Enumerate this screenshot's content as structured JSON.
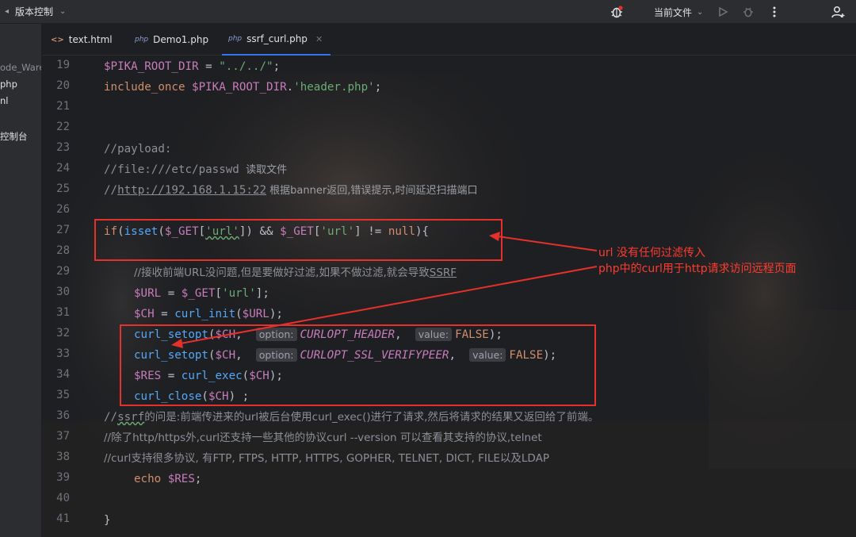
{
  "titlebar": {
    "vcs_label": "版本控制",
    "current_file_label": "当前文件",
    "icons": [
      "menu-icon",
      "debug-bug-icon",
      "run-icon",
      "debug-icon",
      "more-icon",
      "add-user-icon"
    ]
  },
  "project_tree": {
    "items": [
      "ode_Ware",
      "php",
      "nl",
      "控制台"
    ]
  },
  "tabs": [
    {
      "label": "text.html",
      "icon": "html-icon"
    },
    {
      "label": "Demo1.php",
      "icon": "php"
    },
    {
      "label": "ssrf_curl.php",
      "icon": "php",
      "active": true
    }
  ],
  "editor": {
    "line_numbers": [
      "19",
      "20",
      "21",
      "22",
      "23",
      "24",
      "25",
      "26",
      "27",
      "28",
      "29",
      "30",
      "31",
      "32",
      "33",
      "34",
      "35",
      "36",
      "37",
      "38",
      "39",
      "40",
      "41"
    ],
    "lines": {
      "l19": {
        "var": "$PIKA_ROOT_DIR",
        "op": " = ",
        "str": "\"../../\"",
        "end": ";"
      },
      "l20": {
        "kw": "include_once ",
        "var": "$PIKA_ROOT_DIR",
        "op": ".",
        "str": "'header.php'",
        "end": ";"
      },
      "l23": {
        "cmt": "//payload:"
      },
      "l24": {
        "cmt": "//file:///etc/passwd",
        "cn": "  读取文件"
      },
      "l25": {
        "cmt1": "//",
        "url": "http://192.168.1.15:22",
        "cn": " 根据banner返回,错误提示,时间延迟扫描端口"
      },
      "l27": {
        "kw1": "if",
        "p1": "(",
        "fn1": "isset",
        "p2": "(",
        "var1": "$_GET",
        "p3": "[",
        "s1": "'url'",
        "p4": "]) && ",
        "var2": "$_GET",
        "p5": "[",
        "s2": "'url'",
        "p6": "] != ",
        "kw2": "null",
        "p7": "){"
      },
      "l29": {
        "cmt": "//接收前端URL没问题,但是要做好过滤,如果不做过滤,就会导致",
        "tail": "SSRF"
      },
      "l30": {
        "var1": "$URL",
        "op": " = ",
        "var2": "$_GET",
        "p1": "[",
        "s": "'url'",
        "p2": "];"
      },
      "l31": {
        "var1": "$CH",
        "op": " = ",
        "fn": "curl_init",
        "p1": "(",
        "var2": "$URL",
        "p2": ");"
      },
      "l32": {
        "fn": "curl_setopt",
        "p1": "(",
        "var": "$CH",
        "p2": ",  ",
        "hint1": "option:",
        "const": "CURLOPT_HEADER",
        "p3": ",  ",
        "hint2": "value:",
        "val": "FALSE",
        "p4": ");"
      },
      "l33": {
        "fn": "curl_setopt",
        "p1": "(",
        "var": "$CH",
        "p2": ",  ",
        "hint1": "option:",
        "const": "CURLOPT_SSL_VERIFYPEER",
        "p3": ",  ",
        "hint2": "value:",
        "val": "FALSE",
        "p4": ");"
      },
      "l34": {
        "var1": "$RES",
        "op": " = ",
        "fn": "curl_exec",
        "p1": "(",
        "var2": "$CH",
        "p2": ");"
      },
      "l35": {
        "fn": "curl_close",
        "p1": "(",
        "var": "$CH",
        "p2": ") ;"
      },
      "l36": {
        "c1": "//",
        "w": "ssrf",
        "c2": "的问是:前端传进来的url被后台使用curl_exec()进行了请求,然后将请求的结果又返回给了前端。"
      },
      "l37": {
        "cmt": "//除了http/https外,curl还支持一些其他的协议curl --version 可以查看其支持的协议,telnet"
      },
      "l38": {
        "cmt": "//curl支持很多协议, 有FTP, FTPS, HTTP, HTTPS, GOPHER, TELNET, DICT, FILE以及LDAP"
      },
      "l39": {
        "kw": "echo ",
        "var": "$RES",
        "end": ";"
      },
      "l41": {
        "p": "}"
      }
    }
  },
  "annotation": {
    "line1": "url 没有任何过滤传入",
    "line2": "php中的curl用于http请求访问远程页面",
    "color": "#ff3b30"
  },
  "colors": {
    "background": "#1e1f22",
    "variable": "#c77dbb",
    "string": "#6aab73",
    "keyword": "#cf8e6d",
    "function": "#56a8f5",
    "comment": "#8c8f96",
    "annotation_red": "#e5302b"
  }
}
